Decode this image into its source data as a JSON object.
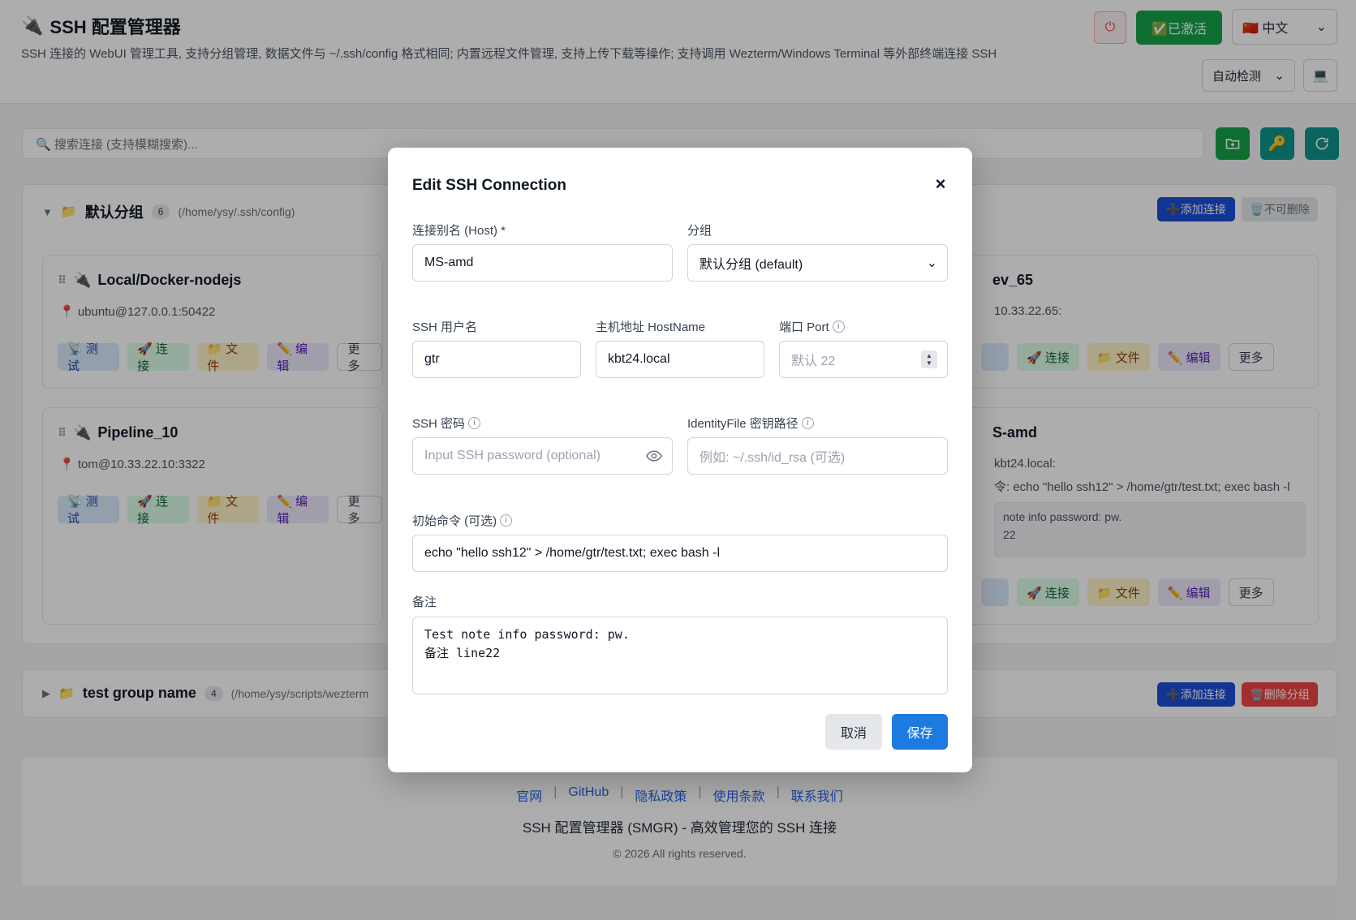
{
  "header": {
    "plug_icon": "🔌",
    "title": "SSH 配置管理器",
    "description": "SSH 连接的 WebUI 管理工具, 支持分组管理, 数据文件与 ~/.ssh/config 格式相同; 内置远程文件管理, 支持上传下载等操作; 支持调用 Wezterm/Windows Terminal 等外部终端连接 SSH",
    "power_icon": "⏻",
    "activated_label": "✅已激活",
    "language": "🇨🇳 中文",
    "terminal_mode": "自动检测",
    "terminal_icon": "💻"
  },
  "search": {
    "placeholder": "🔍 搜索连接 (支持模糊搜索)..."
  },
  "groups": [
    {
      "name": "默认分组",
      "count": "6",
      "path": "(/home/ysy/.ssh/config)",
      "add_label": "➕添加连接",
      "delete_label": "🗑️不可删除"
    },
    {
      "name": "test group name",
      "count": "4",
      "path": "(/home/ysy/scripts/wezterm",
      "add_label": "➕添加连接",
      "delete_label": "🗑️删除分组"
    }
  ],
  "cards": [
    {
      "title": "Local/Docker-nodejs",
      "address": "📍 ubuntu@127.0.0.1:50422"
    },
    {
      "title": "Pipeline_10",
      "address": "📍 tom@10.33.22.10:3322"
    },
    {
      "title": "ev_65",
      "address": "10.33.22.65:"
    },
    {
      "title": "S-amd",
      "address": "kbt24.local:",
      "command": "令: echo \"hello ssh12\" > /home/gtr/test.txt; exec bash -l",
      "note_line1": "note info password: pw.",
      "note_line2": "22"
    }
  ],
  "card_actions": {
    "test": "📡 测试",
    "connect": "🚀 连接",
    "file": "📁 文件",
    "edit": "✏️ 编辑",
    "more": "更多"
  },
  "footer": {
    "links": [
      "官网",
      "GitHub",
      "隐私政策",
      "使用条款",
      "联系我们"
    ],
    "separator": "|",
    "brand": "SSH 配置管理器 (SMGR) - 高效管理您的 SSH 连接",
    "copyright": "© 2026 All rights reserved."
  },
  "modal": {
    "title": "Edit SSH Connection",
    "close": "×",
    "host_label": "连接别名 (Host) *",
    "host_value": "MS-amd",
    "group_label": "分组",
    "group_value": "默认分组 (default)",
    "user_label": "SSH 用户名",
    "user_value": "gtr",
    "hostname_label": "主机地址 HostName",
    "hostname_value": "kbt24.local",
    "port_label": "端口 Port",
    "port_placeholder": "默认 22",
    "password_label": "SSH 密码",
    "password_placeholder": "Input SSH password (optional)",
    "identity_label": "IdentityFile 密钥路径",
    "identity_placeholder": "例如: ~/.ssh/id_rsa (可选)",
    "initcmd_label": "初始命令 (可选)",
    "initcmd_value": "echo \"hello ssh12\" > /home/gtr/test.txt; exec bash -l",
    "note_label": "备注",
    "note_value": "Test note info password: pw.\n备注 line22",
    "cancel": "取消",
    "save": "保存"
  }
}
